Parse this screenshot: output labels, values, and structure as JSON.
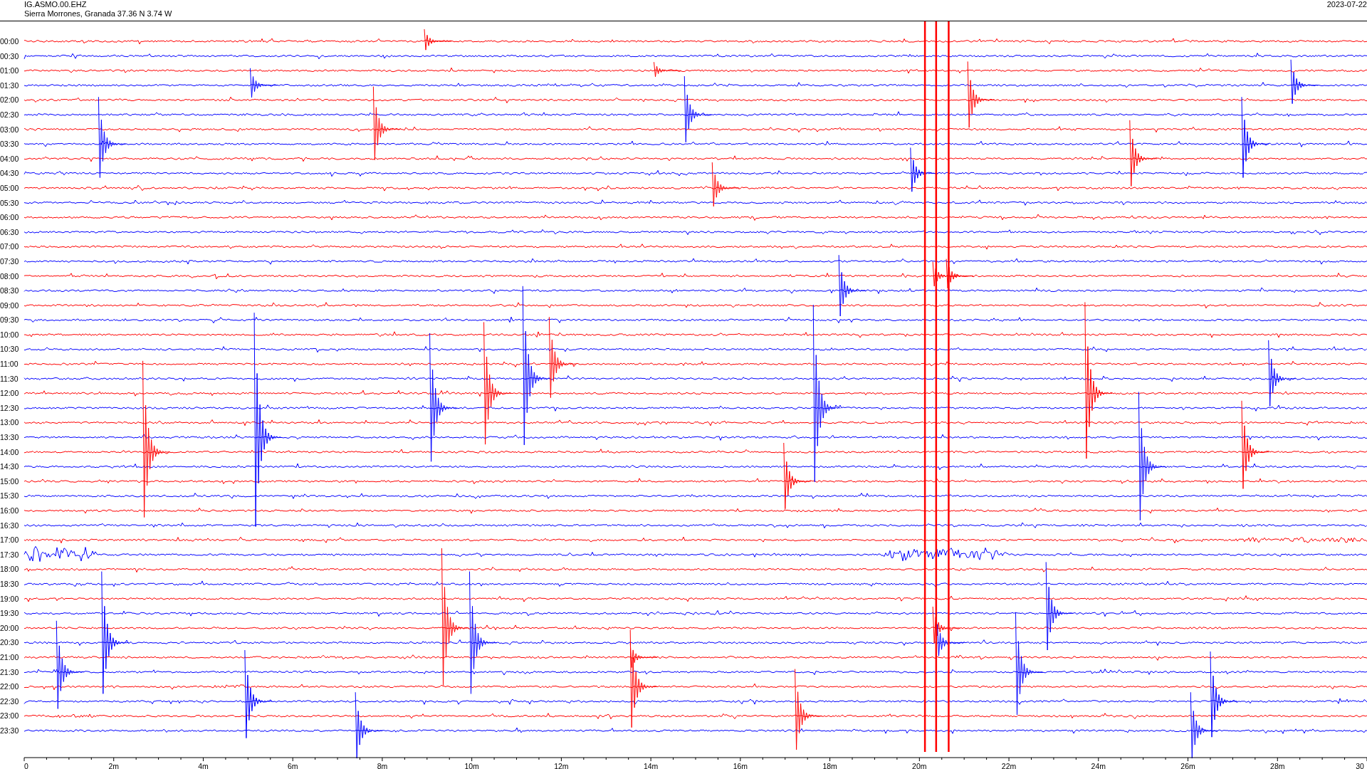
{
  "station": {
    "code": "IG.ASMO.00.EHZ",
    "location": "Sierra Morrones, Granada  37.36 N 3.74 W"
  },
  "date": "2023-07-22",
  "rows": [
    {
      "time": "00:00",
      "color": "#ff0000"
    },
    {
      "time": "00:30",
      "color": "#0000ff"
    },
    {
      "time": "01:00",
      "color": "#ff0000"
    },
    {
      "time": "01:30",
      "color": "#0000ff"
    },
    {
      "time": "02:00",
      "color": "#ff0000"
    },
    {
      "time": "02:30",
      "color": "#0000ff"
    },
    {
      "time": "03:00",
      "color": "#ff0000"
    },
    {
      "time": "03:30",
      "color": "#0000ff"
    },
    {
      "time": "04:00",
      "color": "#ff0000"
    },
    {
      "time": "04:30",
      "color": "#0000ff"
    },
    {
      "time": "05:00",
      "color": "#ff0000"
    },
    {
      "time": "05:30",
      "color": "#0000ff"
    },
    {
      "time": "06:00",
      "color": "#ff0000"
    },
    {
      "time": "06:30",
      "color": "#0000ff"
    },
    {
      "time": "07:00",
      "color": "#ff0000"
    },
    {
      "time": "07:30",
      "color": "#0000ff"
    },
    {
      "time": "08:00",
      "color": "#ff0000"
    },
    {
      "time": "08:30",
      "color": "#0000ff"
    },
    {
      "time": "09:00",
      "color": "#ff0000"
    },
    {
      "time": "09:30",
      "color": "#0000ff"
    },
    {
      "time": "10:00",
      "color": "#ff0000"
    },
    {
      "time": "10:30",
      "color": "#0000ff"
    },
    {
      "time": "11:00",
      "color": "#ff0000"
    },
    {
      "time": "11:30",
      "color": "#0000ff"
    },
    {
      "time": "12:00",
      "color": "#ff0000"
    },
    {
      "time": "12:30",
      "color": "#0000ff"
    },
    {
      "time": "13:00",
      "color": "#ff0000"
    },
    {
      "time": "13:30",
      "color": "#0000ff"
    },
    {
      "time": "14:00",
      "color": "#ff0000"
    },
    {
      "time": "14:30",
      "color": "#0000ff"
    },
    {
      "time": "15:00",
      "color": "#ff0000"
    },
    {
      "time": "15:30",
      "color": "#0000ff"
    },
    {
      "time": "16:00",
      "color": "#ff0000"
    },
    {
      "time": "16:30",
      "color": "#0000ff"
    },
    {
      "time": "17:00",
      "color": "#ff0000"
    },
    {
      "time": "17:30",
      "color": "#0000ff"
    },
    {
      "time": "18:00",
      "color": "#ff0000"
    },
    {
      "time": "18:30",
      "color": "#0000ff"
    },
    {
      "time": "19:00",
      "color": "#ff0000"
    },
    {
      "time": "19:30",
      "color": "#0000ff"
    },
    {
      "time": "20:00",
      "color": "#ff0000"
    },
    {
      "time": "20:30",
      "color": "#0000ff"
    },
    {
      "time": "21:00",
      "color": "#ff0000"
    },
    {
      "time": "21:30",
      "color": "#0000ff"
    },
    {
      "time": "22:00",
      "color": "#ff0000"
    },
    {
      "time": "22:30",
      "color": "#0000ff"
    },
    {
      "time": "23:00",
      "color": "#ff0000"
    },
    {
      "time": "23:30",
      "color": "#0000ff"
    }
  ],
  "x_axis": {
    "ticks": [
      "0",
      "2m",
      "4m",
      "6m",
      "8m",
      "10m",
      "12m",
      "14m",
      "16m",
      "18m",
      "20m",
      "22m",
      "24m",
      "26m",
      "28m",
      "30"
    ]
  }
}
